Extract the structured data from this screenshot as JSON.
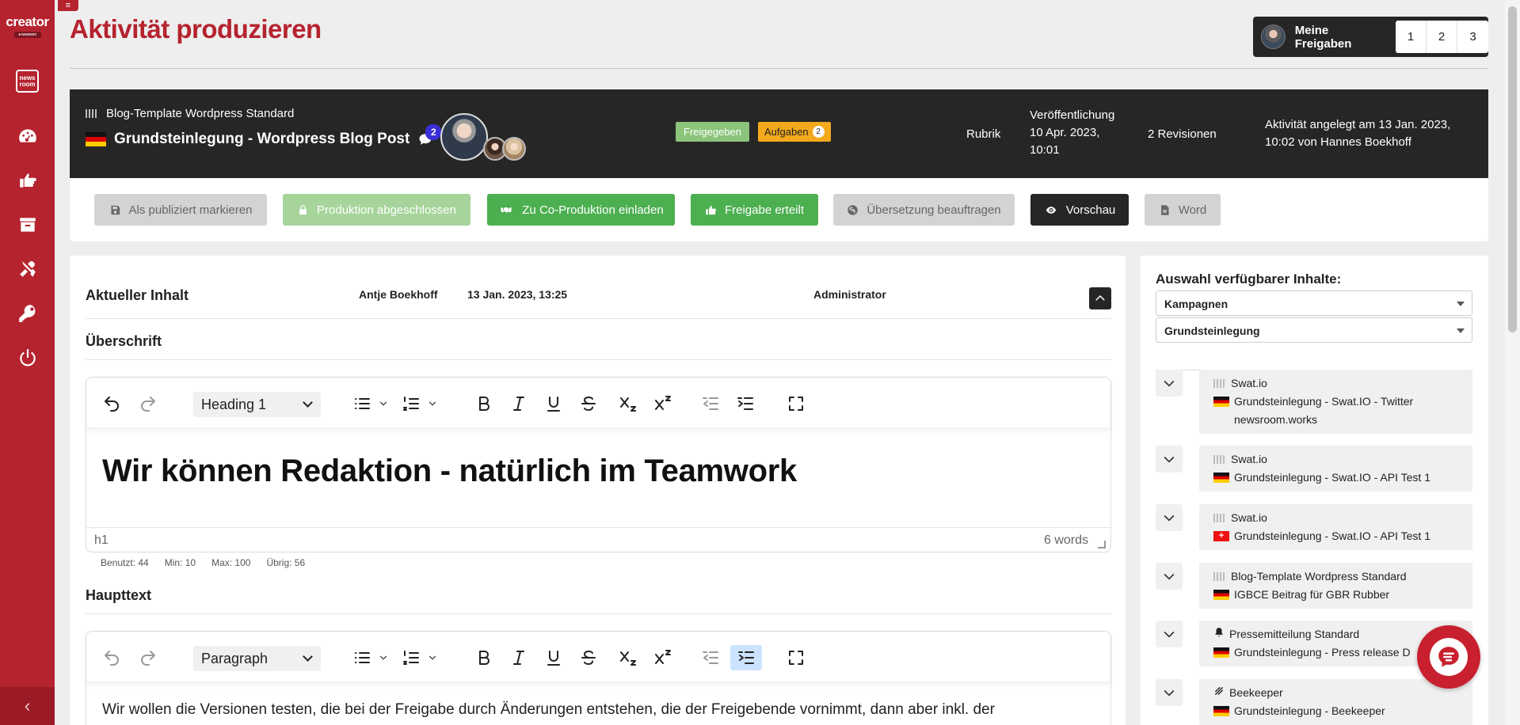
{
  "app": {
    "brand": "creator",
    "brand_sub": "● newsroom",
    "newsroom_logo": "news room",
    "menu_toggle": "≡",
    "collapse": "‹"
  },
  "page": {
    "title": "Aktivität produzieren"
  },
  "approvals": {
    "label": "Meine Freigaben",
    "pages": [
      "1",
      "2",
      "3"
    ]
  },
  "banner": {
    "template": "Blog-Template Wordpress Standard",
    "post_title": "Grundsteinlegung - Wordpress Blog Post",
    "comment_count": "2",
    "tag_approved": "Freigegeben",
    "tag_tasks": "Aufgaben",
    "tasks_count": "2",
    "rubrik": "Rubrik",
    "publish_label": "Veröffentlichung",
    "publish_date": "10 Apr. 2023, 10:01",
    "revisions": "2 Revisionen",
    "created": "Aktivität angelegt am 13 Jan. 2023, 10:02 von Hannes Boekhoff"
  },
  "actions": {
    "mark_published": "Als publiziert markieren",
    "production_done": "Produktion abgeschlossen",
    "invite_coproduction": "Zu Co-Produktion einladen",
    "approval_given": "Freigabe erteilt",
    "order_translation": "Übersetzung beauftragen",
    "preview": "Vorschau",
    "word": "Word"
  },
  "content": {
    "title": "Aktueller Inhalt",
    "author": "Antje Boekhoff",
    "date": "13 Jan. 2023, 13:25",
    "role": "Administrator",
    "heading_label": "Überschrift",
    "heading_editor": {
      "block_format": "Heading 1",
      "text": "Wir können Redaktion - natürlich im Teamwork",
      "path": "h1",
      "word_count": "6 words"
    },
    "counts": {
      "used": "Benutzt: 44",
      "min": "Min: 10",
      "max": "Max: 100",
      "remaining": "Übrig: 56"
    },
    "body_label": "Haupttext",
    "body_editor": {
      "block_format": "Paragraph",
      "text": "Wir wollen die Versionen testen, die bei der Freigabe durch Änderungen entstehen, die der Freigebende vornimmt, dann aber inkl. der"
    }
  },
  "side": {
    "title": "Auswahl verfügbarer Inhalte:",
    "dropdown1": "Kampagnen",
    "dropdown2": "Grundsteinlegung",
    "items": [
      {
        "channel": "Swat.io",
        "title": "Grundsteinlegung - Swat.IO - Twitter newsroom.works",
        "flag": "de",
        "icon": "bars-icon"
      },
      {
        "channel": "Swat.io",
        "title": "Grundsteinlegung - Swat.IO - API Test 1",
        "flag": "de",
        "icon": "bars-icon"
      },
      {
        "channel": "Swat.io",
        "title": "Grundsteinlegung - Swat.IO - API Test 1",
        "flag": "ch",
        "icon": "bars-icon"
      },
      {
        "channel": "Blog-Template Wordpress Standard",
        "title": "IGBCE Beitrag für GBR Rubber",
        "flag": "de",
        "icon": "bars-icon"
      },
      {
        "channel": "Pressemitteilung Standard",
        "title": "Grundsteinlegung - Press release D",
        "flag": "de",
        "icon": "bell-icon"
      },
      {
        "channel": "Beekeeper",
        "title": "Grundsteinlegung - Beekeeper",
        "flag": "de",
        "icon": "beekeeper-icon"
      }
    ]
  },
  "colors": {
    "brand": "#b5232f",
    "dark": "#262626",
    "green": "#4caf50",
    "light_green": "#8bc47a",
    "orange": "#f3a91c",
    "badge": "#3a2fd6"
  }
}
